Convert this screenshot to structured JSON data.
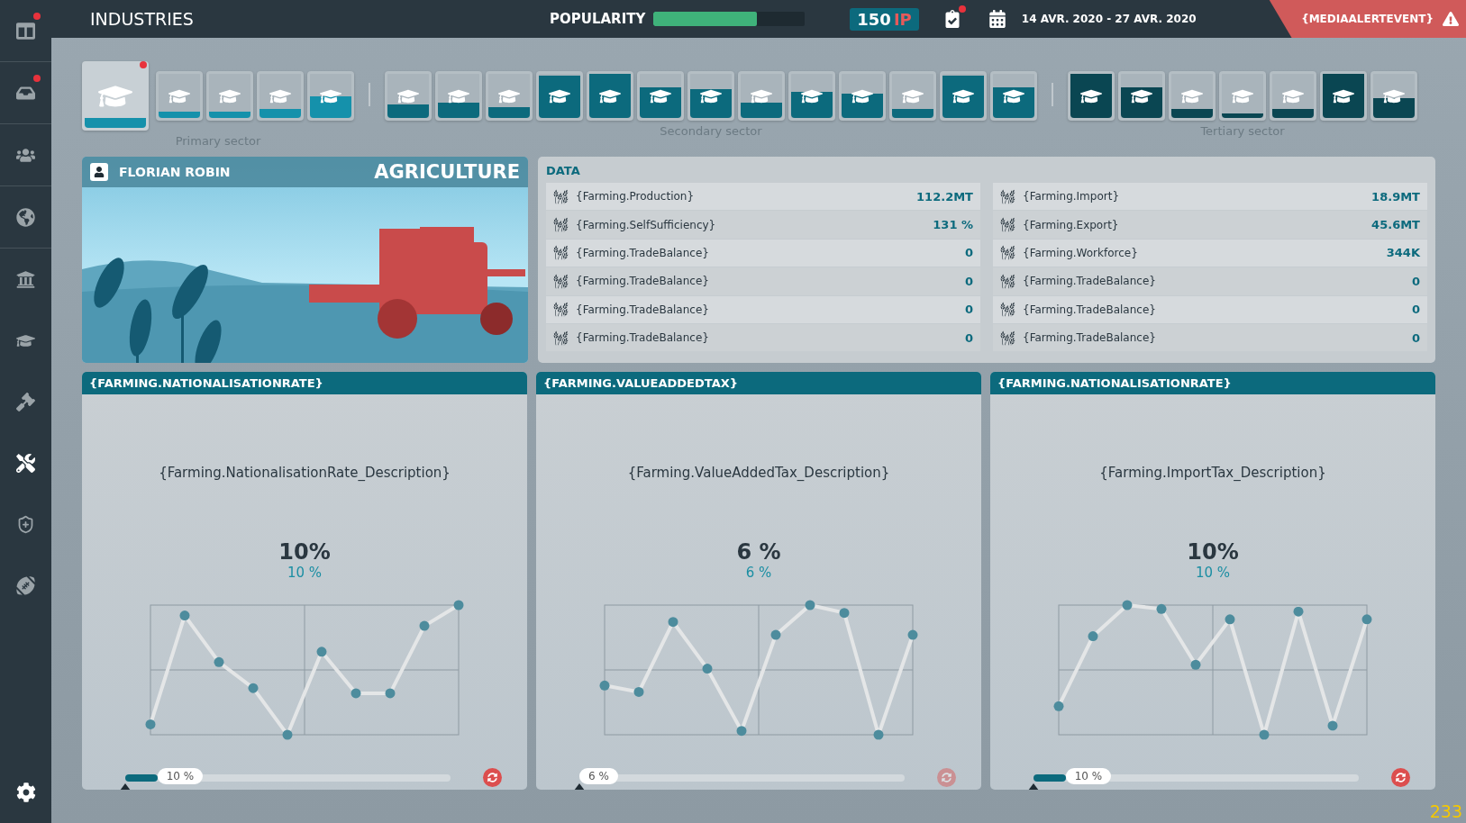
{
  "sidebar": {
    "items": [
      {
        "selected": false,
        "badge": true
      },
      {
        "selected": false,
        "badge": true
      },
      {
        "selected": false,
        "badge": false
      },
      {
        "selected": false,
        "badge": false
      },
      {
        "selected": false,
        "badge": false
      },
      {
        "selected": false,
        "badge": false
      },
      {
        "selected": false,
        "badge": false
      },
      {
        "selected": true,
        "badge": false
      },
      {
        "selected": false,
        "badge": false
      },
      {
        "selected": false,
        "badge": false
      }
    ]
  },
  "top_bar": {
    "title": "INDUSTRIES",
    "popularity": {
      "label": "POPULARITY",
      "level": 0.68
    },
    "points": {
      "value": "150",
      "unit": "IP"
    },
    "tasks_badge": true,
    "date_range": "14 AVR. 2020 - 27 AVR. 2020",
    "alert": "{MEDIAALERTEVENT}"
  },
  "sectors": [
    {
      "label": "Primary sector",
      "color": "#1591ab",
      "tiles": [
        {
          "selected": true,
          "badge": true,
          "level": 0.15
        },
        {
          "selected": false,
          "badge": false,
          "level": 0.15
        },
        {
          "selected": false,
          "badge": false,
          "level": 0.15
        },
        {
          "selected": false,
          "badge": false,
          "level": 0.2
        },
        {
          "selected": false,
          "badge": false,
          "level": 0.5
        }
      ]
    },
    {
      "label": "Secondary sector",
      "color": "#0c6a7d",
      "tiles": [
        {
          "selected": false,
          "badge": false,
          "level": 0.3
        },
        {
          "selected": false,
          "badge": false,
          "level": 0.35
        },
        {
          "selected": false,
          "badge": false,
          "level": 0.25
        },
        {
          "selected": false,
          "badge": false,
          "level": 0.95
        },
        {
          "selected": false,
          "badge": false,
          "level": 1
        },
        {
          "selected": false,
          "badge": false,
          "level": 0.7
        },
        {
          "selected": false,
          "badge": false,
          "level": 0.65
        },
        {
          "selected": false,
          "badge": false,
          "level": 0.35
        },
        {
          "selected": false,
          "badge": false,
          "level": 0.6
        },
        {
          "selected": false,
          "badge": false,
          "level": 0.55
        },
        {
          "selected": false,
          "badge": false,
          "level": 0.2
        },
        {
          "selected": false,
          "badge": false,
          "level": 0.95
        },
        {
          "selected": false,
          "badge": false,
          "level": 0.7
        }
      ]
    },
    {
      "label": "Tertiary sector",
      "color": "#0a4652",
      "tiles": [
        {
          "selected": false,
          "badge": false,
          "level": 1
        },
        {
          "selected": false,
          "badge": false,
          "level": 0.7
        },
        {
          "selected": false,
          "badge": false,
          "level": 0.2
        },
        {
          "selected": false,
          "badge": false,
          "level": 0.1
        },
        {
          "selected": false,
          "badge": false,
          "level": 0.2
        },
        {
          "selected": false,
          "badge": false,
          "level": 1
        },
        {
          "selected": false,
          "badge": false,
          "level": 0.45
        }
      ]
    }
  ],
  "industry_card": {
    "minister": "FLORIAN ROBIN",
    "title": "AGRICULTURE"
  },
  "data_panel": {
    "title": "DATA",
    "columns": [
      [
        {
          "label": "{Farming.Production}",
          "value": "112.2MT"
        },
        {
          "label": "{Farming.SelfSufficiency}",
          "value": "131 %"
        },
        {
          "label": "{Farming.TradeBalance}",
          "value": "0"
        },
        {
          "label": "{Farming.TradeBalance}",
          "value": "0"
        },
        {
          "label": "{Farming.TradeBalance}",
          "value": "0"
        },
        {
          "label": "{Farming.TradeBalance}",
          "value": "0"
        }
      ],
      [
        {
          "label": "{Farming.Import}",
          "value": "18.9MT"
        },
        {
          "label": "{Farming.Export}",
          "value": "45.6MT"
        },
        {
          "label": "{Farming.Workforce}",
          "value": "344K"
        },
        {
          "label": "{Farming.TradeBalance}",
          "value": "0"
        },
        {
          "label": "{Farming.TradeBalance}",
          "value": "0"
        },
        {
          "label": "{Farming.TradeBalance}",
          "value": "0"
        }
      ]
    ]
  },
  "policies": [
    {
      "title": "{FARMING.NATIONALISATIONRATE}",
      "description": "{Farming.NationalisationRate_Description}",
      "value": "10%",
      "sub_value": "10 %",
      "slider": {
        "label": "10 %",
        "level": 0.06
      },
      "reset_disabled": false
    },
    {
      "title": "{FARMING.VALUEADDEDTAX}",
      "description": "{Farming.ValueAddedTax_Description}",
      "value": "6 %",
      "sub_value": "6 %",
      "slider": {
        "label": "6 %",
        "level": 0.0
      },
      "reset_disabled": true
    },
    {
      "title": "{FARMING.NATIONALISATIONRATE}",
      "description": "{Farming.ImportTax_Description}",
      "value": "10%",
      "sub_value": "10 %",
      "slider": {
        "label": "10 %",
        "level": 0.06
      },
      "reset_disabled": false
    }
  ],
  "fps_counter": "233"
}
